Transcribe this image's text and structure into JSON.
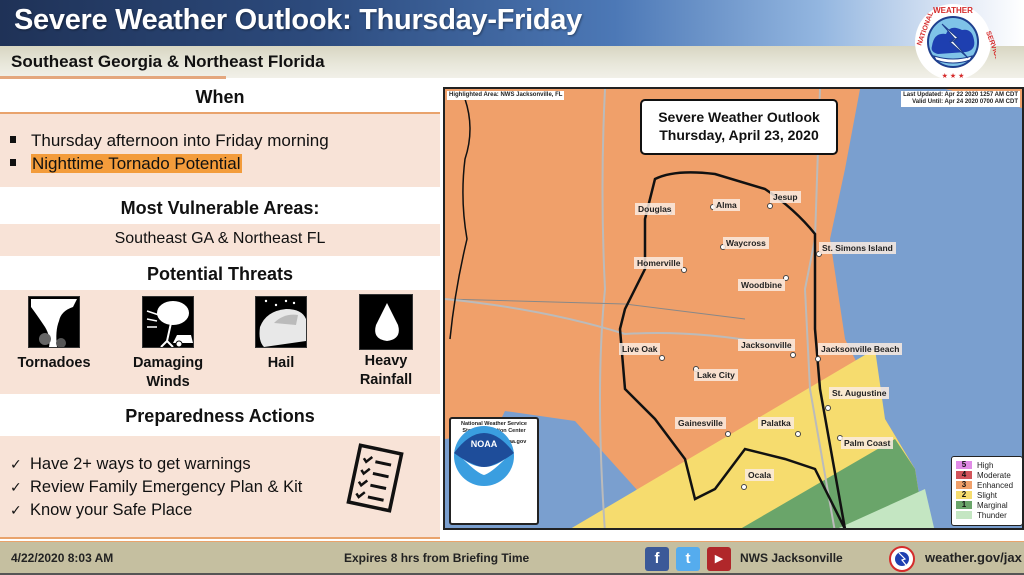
{
  "header": {
    "title": "Severe Weather Outlook: Thursday-Friday",
    "subtitle": "Southeast Georgia & Northeast Florida",
    "logo_text": "NATIONAL WEATHER SERVICE"
  },
  "left_panel": {
    "when": {
      "heading": "When",
      "bullets": [
        "Thursday afternoon into Friday morning",
        "Nighttime Tornado Potential"
      ]
    },
    "vulnerable": {
      "heading": "Most Vulnerable Areas:",
      "text": "Southeast GA & Northeast FL"
    },
    "threats": {
      "heading": "Potential Threats",
      "items": [
        {
          "label_1": "Tornadoes",
          "label_2": "",
          "icon": "tornado-icon"
        },
        {
          "label_1": "Damaging",
          "label_2": "Winds",
          "icon": "wind-damage-icon"
        },
        {
          "label_1": "Hail",
          "label_2": "",
          "icon": "hail-icon"
        },
        {
          "label_1": "Heavy",
          "label_2": "Rainfall",
          "icon": "raindrop-icon"
        }
      ]
    },
    "preparedness": {
      "heading": "Preparedness Actions",
      "items": [
        "Have 2+ ways to get warnings",
        "Review Family Emergency Plan & Kit",
        "Know your Safe Place"
      ],
      "check_glyph": "✓"
    }
  },
  "map": {
    "highlighted_area": "Highlighted Area: NWS Jacksonville, FL",
    "last_updated": "Last Updated: Apr 22 2020 1257 AM CDT",
    "valid_until": "Valid Until: Apr 24 2020 0700 AM CDT",
    "title_line1": "Severe Weather Outlook",
    "title_line2": "Thursday, April 23, 2020",
    "cities": [
      "Douglas",
      "Alma",
      "Jesup",
      "Waycross",
      "St. Simons Island",
      "Homerville",
      "Woodbine",
      "Live Oak",
      "Jacksonville",
      "Jacksonville Beach",
      "Lake City",
      "St. Augustine",
      "Gainesville",
      "Palatka",
      "Palm Coast",
      "Ocala"
    ],
    "noaa_box": {
      "logo_text": "NOAA",
      "line1": "National Weather Service",
      "line2": "Storm Prediction Center",
      "url": "http://www.spc.noaa.gov"
    },
    "legend": [
      {
        "num": "5",
        "label": "High",
        "color": "#e08be6"
      },
      {
        "num": "4",
        "label": "Moderate",
        "color": "#d2545a"
      },
      {
        "num": "3",
        "label": "Enhanced",
        "color": "#f0a06a"
      },
      {
        "num": "2",
        "label": "Slight",
        "color": "#f6dc6e"
      },
      {
        "num": "1",
        "label": "Marginal",
        "color": "#6aa56a"
      },
      {
        "num": "",
        "label": "Thunder",
        "color": "#c4e6c2"
      }
    ]
  },
  "footer": {
    "timestamp": "4/22/2020 8:03 AM",
    "expires": "Expires 8 hrs from Briefing Time",
    "social_handle": "NWS Jacksonville",
    "website": "weather.gov/jax",
    "facebook_glyph": "f",
    "twitter_glyph": "t",
    "youtube_glyph": "▶"
  },
  "colors": {
    "enhanced": "#f0a06a",
    "slight": "#f6dc6e",
    "marginal": "#6aa56a",
    "thunder": "#c4e6c2",
    "water": "#7a9fcf",
    "highlight": "#f39c3b",
    "peach_bg": "#f8e3d7"
  }
}
